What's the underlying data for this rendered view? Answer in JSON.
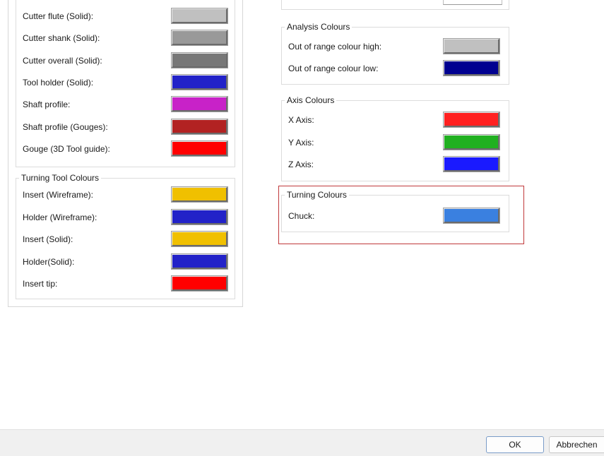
{
  "left_panel": {
    "cutter_rows": [
      {
        "label": "Cutter flute (Solid):",
        "color": "#c0c0c0"
      },
      {
        "label": "Cutter shank (Solid):",
        "color": "#999999"
      },
      {
        "label": "Cutter overall (Solid):",
        "color": "#777777"
      },
      {
        "label": "Tool holder (Solid):",
        "color": "#2222c8"
      },
      {
        "label": "Shaft profile:",
        "color": "#c822c8"
      },
      {
        "label": "Shaft profile (Gouges):",
        "color": "#b22222"
      },
      {
        "label": "Gouge (3D Tool guide):",
        "color": "#ff0000"
      }
    ],
    "turning_tool": {
      "title": "Turning Tool Colours",
      "rows": [
        {
          "label": "Insert (Wireframe):",
          "color": "#f0c000"
        },
        {
          "label": "Holder (Wireframe):",
          "color": "#2222c8"
        },
        {
          "label": "Insert (Solid):",
          "color": "#f0c000"
        },
        {
          "label": "Holder(Solid):",
          "color": "#2222c8"
        },
        {
          "label": "Insert tip:",
          "color": "#ff0000"
        }
      ]
    }
  },
  "right_panel": {
    "analysis": {
      "title": "Analysis Colours",
      "rows": [
        {
          "label": "Out of range colour high:",
          "color": "#c0c0c0"
        },
        {
          "label": "Out of range colour low:",
          "color": "#000090"
        }
      ]
    },
    "axis": {
      "title": "Axis Colours",
      "rows": [
        {
          "label": "X Axis:",
          "color": "#ff2020"
        },
        {
          "label": "Y Axis:",
          "color": "#20b020"
        },
        {
          "label": "Z Axis:",
          "color": "#1a1aff"
        }
      ]
    },
    "turning": {
      "title": "Turning Colours",
      "rows": [
        {
          "label": "Chuck:",
          "color": "#3a80e0"
        }
      ],
      "highlight_color": "#c0393b"
    }
  },
  "footer": {
    "ok_label": "OK",
    "cancel_label": "Abbrechen"
  }
}
